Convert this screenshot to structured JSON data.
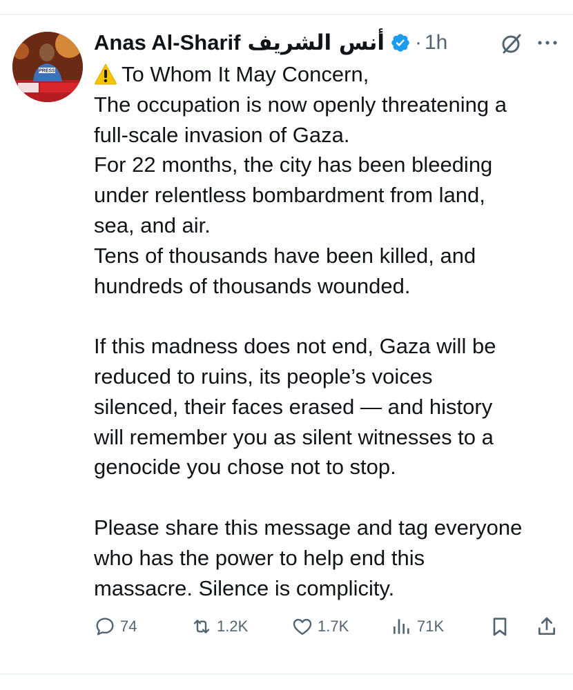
{
  "header": {
    "name": "Anas Al-Sharif",
    "name_arabic": "أنس الشريف",
    "separator": "·",
    "time": "1h"
  },
  "avatar": {
    "press_label": "PRESS"
  },
  "tweet": {
    "lines": [
      "To Whom It May Concern,",
      "The occupation is now openly threatening a",
      "full-scale invasion of Gaza.",
      "For 22 months, the city has been bleeding",
      "under relentless bombardment from land,",
      "sea, and air.",
      "Tens of thousands have been killed, and",
      "hundreds of thousands wounded.",
      "If this madness does not end, Gaza will be",
      "reduced to ruins, its people’s voices",
      "silenced, their faces erased — and history",
      "will remember you as silent witnesses to a",
      "genocide you chose not to stop.",
      "Please share this message and tag everyone",
      "who has the power to help end this",
      "massacre. Silence is complicity."
    ]
  },
  "actions": {
    "replies": "74",
    "reposts": "1.2K",
    "likes": "1.7K",
    "views": "71K"
  },
  "icons": {
    "warning": "warning-icon",
    "verified": "verified-badge-icon",
    "grok": "grok-icon",
    "more": "more-icon",
    "reply": "reply-icon",
    "repost": "repost-icon",
    "like": "heart-icon",
    "views": "views-icon",
    "bookmark": "bookmark-icon",
    "share": "share-icon"
  },
  "colors": {
    "text": "#0f1419",
    "secondary": "#536471",
    "verified": "#1d9bf0",
    "warning": "#f5c400",
    "divider": "#eff3f4"
  }
}
